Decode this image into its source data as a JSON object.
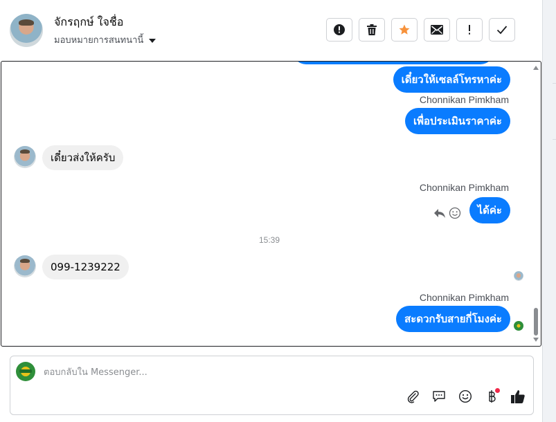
{
  "header": {
    "contact_name": "จักรฤกษ์ ใจชื่อ",
    "assign_label": "มอบหมายการสนทนานี้",
    "toolbar": [
      {
        "name": "spam-button",
        "icon": "alert-circle-icon",
        "glyph": "!"
      },
      {
        "name": "delete-button",
        "icon": "trash-icon",
        "glyph": ""
      },
      {
        "name": "star-button",
        "icon": "star-icon",
        "glyph": "★",
        "color": "#f7923b"
      },
      {
        "name": "mark-unread-button",
        "icon": "envelope-icon",
        "glyph": ""
      },
      {
        "name": "follow-up-button",
        "icon": "exclamation-icon",
        "glyph": "!"
      },
      {
        "name": "done-button",
        "icon": "check-icon",
        "glyph": ""
      }
    ]
  },
  "conversation": {
    "messages": [
      {
        "id": "m1",
        "direction": "out",
        "text": "เดี๋ยวให้เซลล์โทรหาค่ะ"
      },
      {
        "id": "m2",
        "direction": "out",
        "sender": "Chonnikan Pimkham",
        "text": "เพื่อประเมินราคาค่ะ"
      },
      {
        "id": "m3",
        "direction": "in",
        "text": "เดี๋ยวส่งให้ครับ"
      },
      {
        "id": "m4",
        "direction": "out",
        "sender": "Chonnikan Pimkham",
        "text": "ได้ค่ะ"
      },
      {
        "id": "m5",
        "direction": "in",
        "text": "099-1239222"
      },
      {
        "id": "m6",
        "direction": "out",
        "sender": "Chonnikan Pimkham",
        "text": "สะดวกรับสายกี่โมงค่ะ"
      }
    ],
    "timestamp": "15:39"
  },
  "composer": {
    "placeholder": "ตอบกลับใน Messenger..."
  },
  "colors": {
    "outgoing_bubble": "#0a7cff",
    "incoming_bubble": "#f0f0f0",
    "star": "#f7923b",
    "notification_dot": "#f02849"
  }
}
